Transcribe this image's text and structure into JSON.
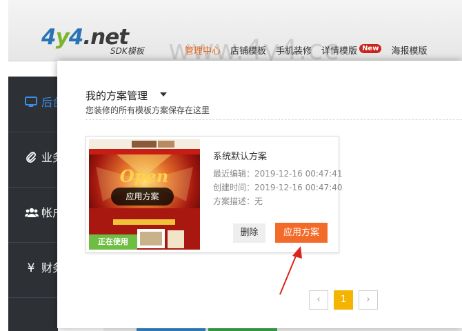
{
  "brand": {
    "logo_text_a": "4",
    "logo_text_b": "y",
    "logo_text_c": "4",
    "logo_text_d": ".net",
    "logo_sub": "SDK模板"
  },
  "watermark": "www.4y4.cc",
  "nav": {
    "items": [
      {
        "label": "管理中心"
      },
      {
        "label": "店铺模板"
      },
      {
        "label": "手机装修"
      },
      {
        "label": "详情模版"
      },
      {
        "label": "海报模版"
      }
    ],
    "new_badge": "New"
  },
  "sidebar": {
    "items": [
      {
        "label": "后台",
        "icon": "monitor-icon"
      },
      {
        "label": "业务",
        "icon": "paperclip-icon"
      },
      {
        "label": "帐户",
        "icon": "users-icon"
      },
      {
        "label": "财务",
        "icon": "yen-icon",
        "icon_glyph": "¥"
      }
    ]
  },
  "modal": {
    "title": "我的方案管理",
    "subtitle": "您装修的所有模板方案保存在这里",
    "plan": {
      "thumb_button": "应用方案",
      "thumb_word": "Open",
      "in_use_label": "正在使用",
      "name": "系统默认方案",
      "edited_label": "最近编辑：",
      "edited_value": "2019-12-16 00:47:41",
      "created_label": "创建时间：",
      "created_value": "2019-12-16 00:47:40",
      "desc_label": "方案描述：",
      "desc_value": "无",
      "delete_label": "删除",
      "apply_label": "应用方案"
    },
    "pagination": {
      "prev": "‹",
      "current": "1",
      "next": "›"
    }
  },
  "colors": {
    "accent_orange": "#f26b2a",
    "in_use_green": "#6fbe44",
    "page_gold": "#f5b400",
    "sidebar_bg": "#2d3034",
    "active_blue": "#3a8ee6"
  }
}
